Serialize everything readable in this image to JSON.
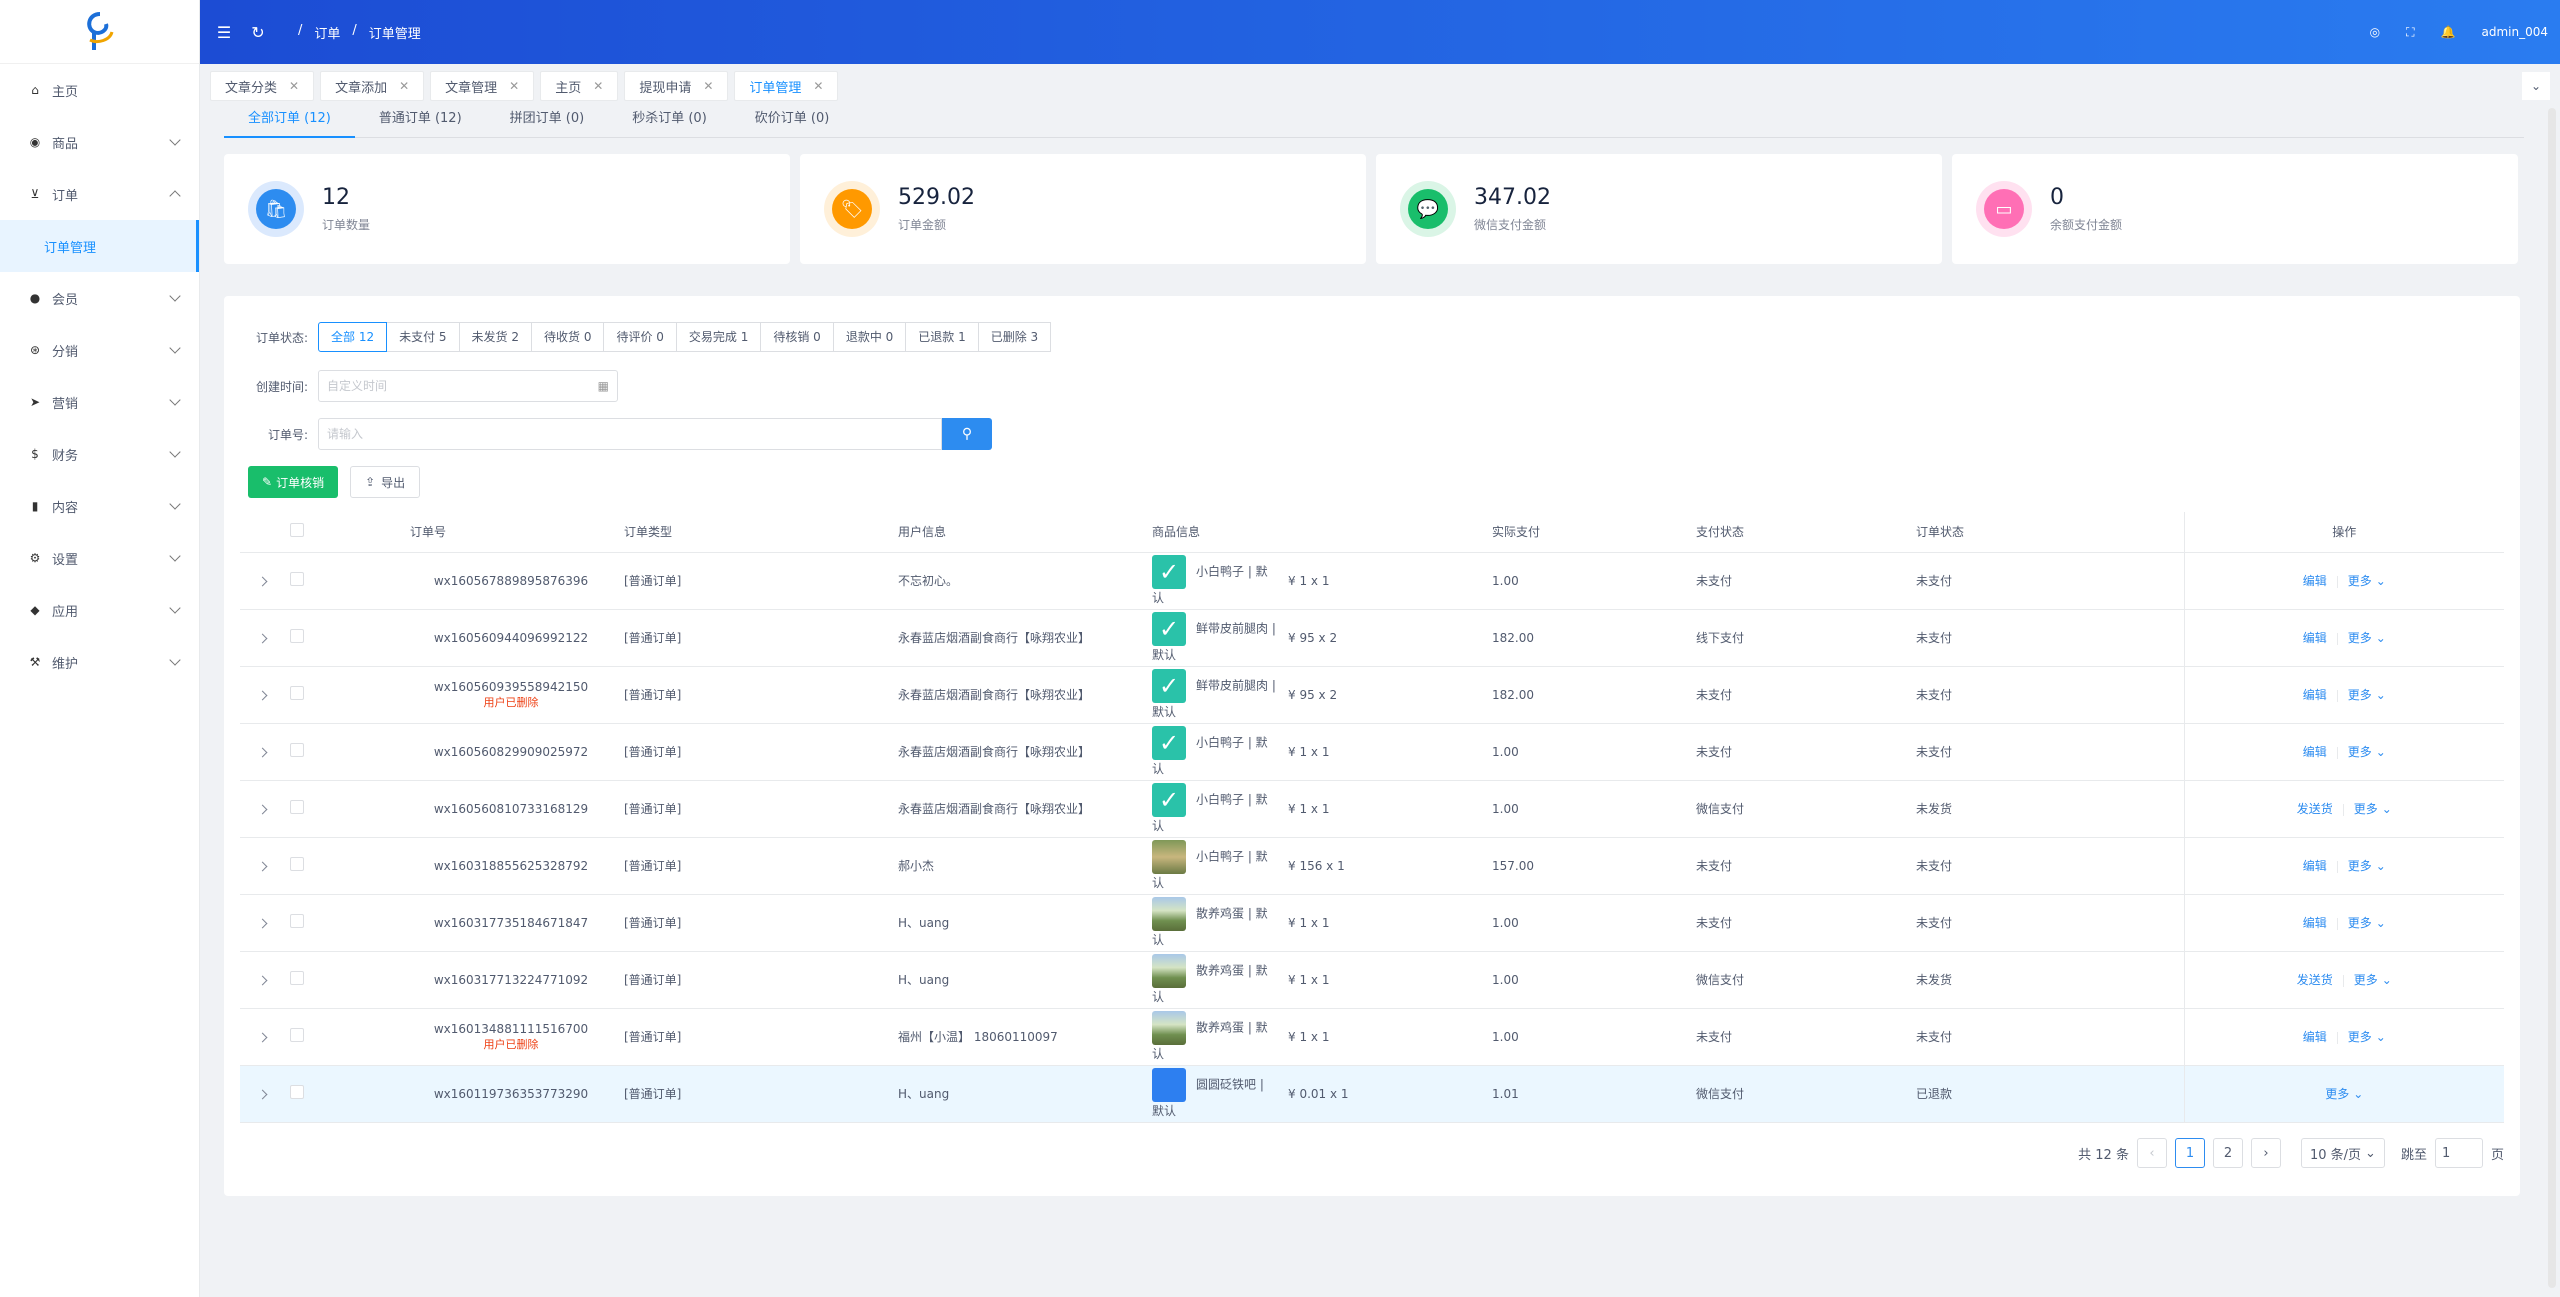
{
  "header": {
    "user": "admin_004",
    "breadcrumb": [
      "/",
      "订单",
      "/",
      "订单管理"
    ]
  },
  "sidebar": {
    "items": [
      {
        "label": "主页",
        "icon": "home-icon",
        "glyph": "⌂",
        "expand": ""
      },
      {
        "label": "商品",
        "icon": "bag-icon",
        "glyph": "◉",
        "expand": "down"
      },
      {
        "label": "订单",
        "icon": "cart-icon",
        "glyph": "⊻",
        "expand": "up"
      },
      {
        "label": "会员",
        "icon": "user-icon",
        "glyph": "●",
        "expand": "down"
      },
      {
        "label": "分销",
        "icon": "share-icon",
        "glyph": "⊛",
        "expand": "down"
      },
      {
        "label": "营销",
        "icon": "send-icon",
        "glyph": "➤",
        "expand": "down"
      },
      {
        "label": "财务",
        "icon": "dollar-icon",
        "glyph": "$",
        "expand": "down"
      },
      {
        "label": "内容",
        "icon": "book-icon",
        "glyph": "▮",
        "expand": "down"
      },
      {
        "label": "设置",
        "icon": "gear-icon",
        "glyph": "⚙",
        "expand": "down"
      },
      {
        "label": "应用",
        "icon": "cube-icon",
        "glyph": "◆",
        "expand": "down"
      },
      {
        "label": "维护",
        "icon": "hammer-icon",
        "glyph": "⚒",
        "expand": "down"
      }
    ],
    "sub": "订单管理"
  },
  "tags": [
    {
      "label": "文章分类"
    },
    {
      "label": "文章添加"
    },
    {
      "label": "文章管理"
    },
    {
      "label": "主页"
    },
    {
      "label": "提现申请"
    },
    {
      "label": "订单管理",
      "active": true
    }
  ],
  "order_tabs": [
    {
      "label": "全部订单 (12)",
      "active": true
    },
    {
      "label": "普通订单 (12)"
    },
    {
      "label": "拼团订单 (0)"
    },
    {
      "label": "秒杀订单 (0)"
    },
    {
      "label": "砍价订单 (0)"
    }
  ],
  "stats": [
    {
      "value": "12",
      "label": "订单数量",
      "color": "#2d8cf0",
      "ring": "#dbe9fd",
      "glyph": "🛍"
    },
    {
      "value": "529.02",
      "label": "订单金额",
      "color": "#ff9900",
      "ring": "#fff0d9",
      "glyph": "🏷"
    },
    {
      "value": "347.02",
      "label": "微信支付金额",
      "color": "#19be6b",
      "ring": "#daf5e6",
      "glyph": "💬"
    },
    {
      "value": "0",
      "label": "余额支付金额",
      "color": "#ff6fb5",
      "ring": "#ffe1f0",
      "glyph": "▭"
    }
  ],
  "filter": {
    "status_label": "订单状态:",
    "status": [
      "全部 12",
      "未支付 5",
      "未发货 2",
      "待收货 0",
      "待评价 0",
      "交易完成 1",
      "待核销 0",
      "退款中 0",
      "已退款 1",
      "已删除 3"
    ],
    "time_label": "创建时间:",
    "time_placeholder": "自定义时间",
    "order_label": "订单号:",
    "order_placeholder": "请输入",
    "btn_verify": "订单核销",
    "btn_export": "导出"
  },
  "table": {
    "headers": [
      "订单号",
      "订单类型",
      "用户信息",
      "商品信息",
      "",
      "实际支付",
      "支付状态",
      "订单状态",
      "操作"
    ],
    "rows": [
      {
        "no": "wx160567889895876396",
        "del": "",
        "type": "[普通订单]",
        "user": "不忘初心。",
        "thumb": "check",
        "goods": "小白鸭子 | 默认",
        "price": "¥ 1 x 1",
        "paid": "1.00",
        "pay": "未支付",
        "status": "未支付",
        "op1": "编辑",
        "more": "更多"
      },
      {
        "no": "wx160560944096992122",
        "del": "",
        "type": "[普通订单]",
        "user": "永春蓝店烟酒副食商行【咏翔农业】",
        "thumb": "check",
        "goods": "鲜带皮前腿肉 | 默认",
        "price": "¥ 95 x 2",
        "paid": "182.00",
        "pay": "线下支付",
        "status": "未支付",
        "op1": "编辑",
        "more": "更多"
      },
      {
        "no": "wx160560939558942150",
        "del": "用户已删除",
        "type": "[普通订单]",
        "user": "永春蓝店烟酒副食商行【咏翔农业】",
        "thumb": "check",
        "goods": "鲜带皮前腿肉 | 默认",
        "price": "¥ 95 x 2",
        "paid": "182.00",
        "pay": "未支付",
        "status": "未支付",
        "op1": "编辑",
        "more": "更多"
      },
      {
        "no": "wx160560829909025972",
        "del": "",
        "type": "[普通订单]",
        "user": "永春蓝店烟酒副食商行【咏翔农业】",
        "thumb": "check",
        "goods": "小白鸭子 | 默认",
        "price": "¥ 1 x 1",
        "paid": "1.00",
        "pay": "未支付",
        "status": "未支付",
        "op1": "编辑",
        "more": "更多"
      },
      {
        "no": "wx160560810733168129",
        "del": "",
        "type": "[普通订单]",
        "user": "永春蓝店烟酒副食商行【咏翔农业】",
        "thumb": "check",
        "goods": "小白鸭子 | 默认",
        "price": "¥ 1 x 1",
        "paid": "1.00",
        "pay": "微信支付",
        "status": "未发货",
        "op1": "发送货",
        "more": "更多"
      },
      {
        "no": "wx160318855625328792",
        "del": "",
        "type": "[普通订单]",
        "user": "郝小杰",
        "thumb": "photo2",
        "goods": "小白鸭子 | 默认",
        "price": "¥ 156 x 1",
        "paid": "157.00",
        "pay": "未支付",
        "status": "未支付",
        "op1": "编辑",
        "more": "更多"
      },
      {
        "no": "wx160317735184671847",
        "del": "",
        "type": "[普通订单]",
        "user": "H、uang",
        "thumb": "photo",
        "goods": "散养鸡蛋 | 默认",
        "price": "¥ 1 x 1",
        "paid": "1.00",
        "pay": "未支付",
        "status": "未支付",
        "op1": "编辑",
        "more": "更多"
      },
      {
        "no": "wx160317713224771092",
        "del": "",
        "type": "[普通订单]",
        "user": "H、uang",
        "thumb": "photo",
        "goods": "散养鸡蛋 | 默认",
        "price": "¥ 1 x 1",
        "paid": "1.00",
        "pay": "微信支付",
        "status": "未发货",
        "op1": "发送货",
        "more": "更多"
      },
      {
        "no": "wx160134881111516700",
        "del": "用户已删除",
        "type": "[普通订单]",
        "user": "福州【小温】 18060110097",
        "thumb": "photo",
        "goods": "散养鸡蛋 | 默认",
        "price": "¥ 1 x 1",
        "paid": "1.00",
        "pay": "未支付",
        "status": "未支付",
        "op1": "编辑",
        "more": "更多"
      },
      {
        "no": "wx160119736353773290",
        "del": "",
        "type": "[普通订单]",
        "user": "H、uang",
        "thumb": "blue",
        "goods": "圆圆砭铁吧 | 默认",
        "price": "¥ 0.01 x 1",
        "paid": "1.01",
        "pay": "微信支付",
        "status": "已退款",
        "op1": "",
        "more": "更多"
      }
    ]
  },
  "pager": {
    "total": "共 12 条",
    "pages": [
      "1",
      "2"
    ],
    "size": "10 条/页",
    "jump": "跳至",
    "jump_value": "1",
    "page_unit": "页"
  }
}
